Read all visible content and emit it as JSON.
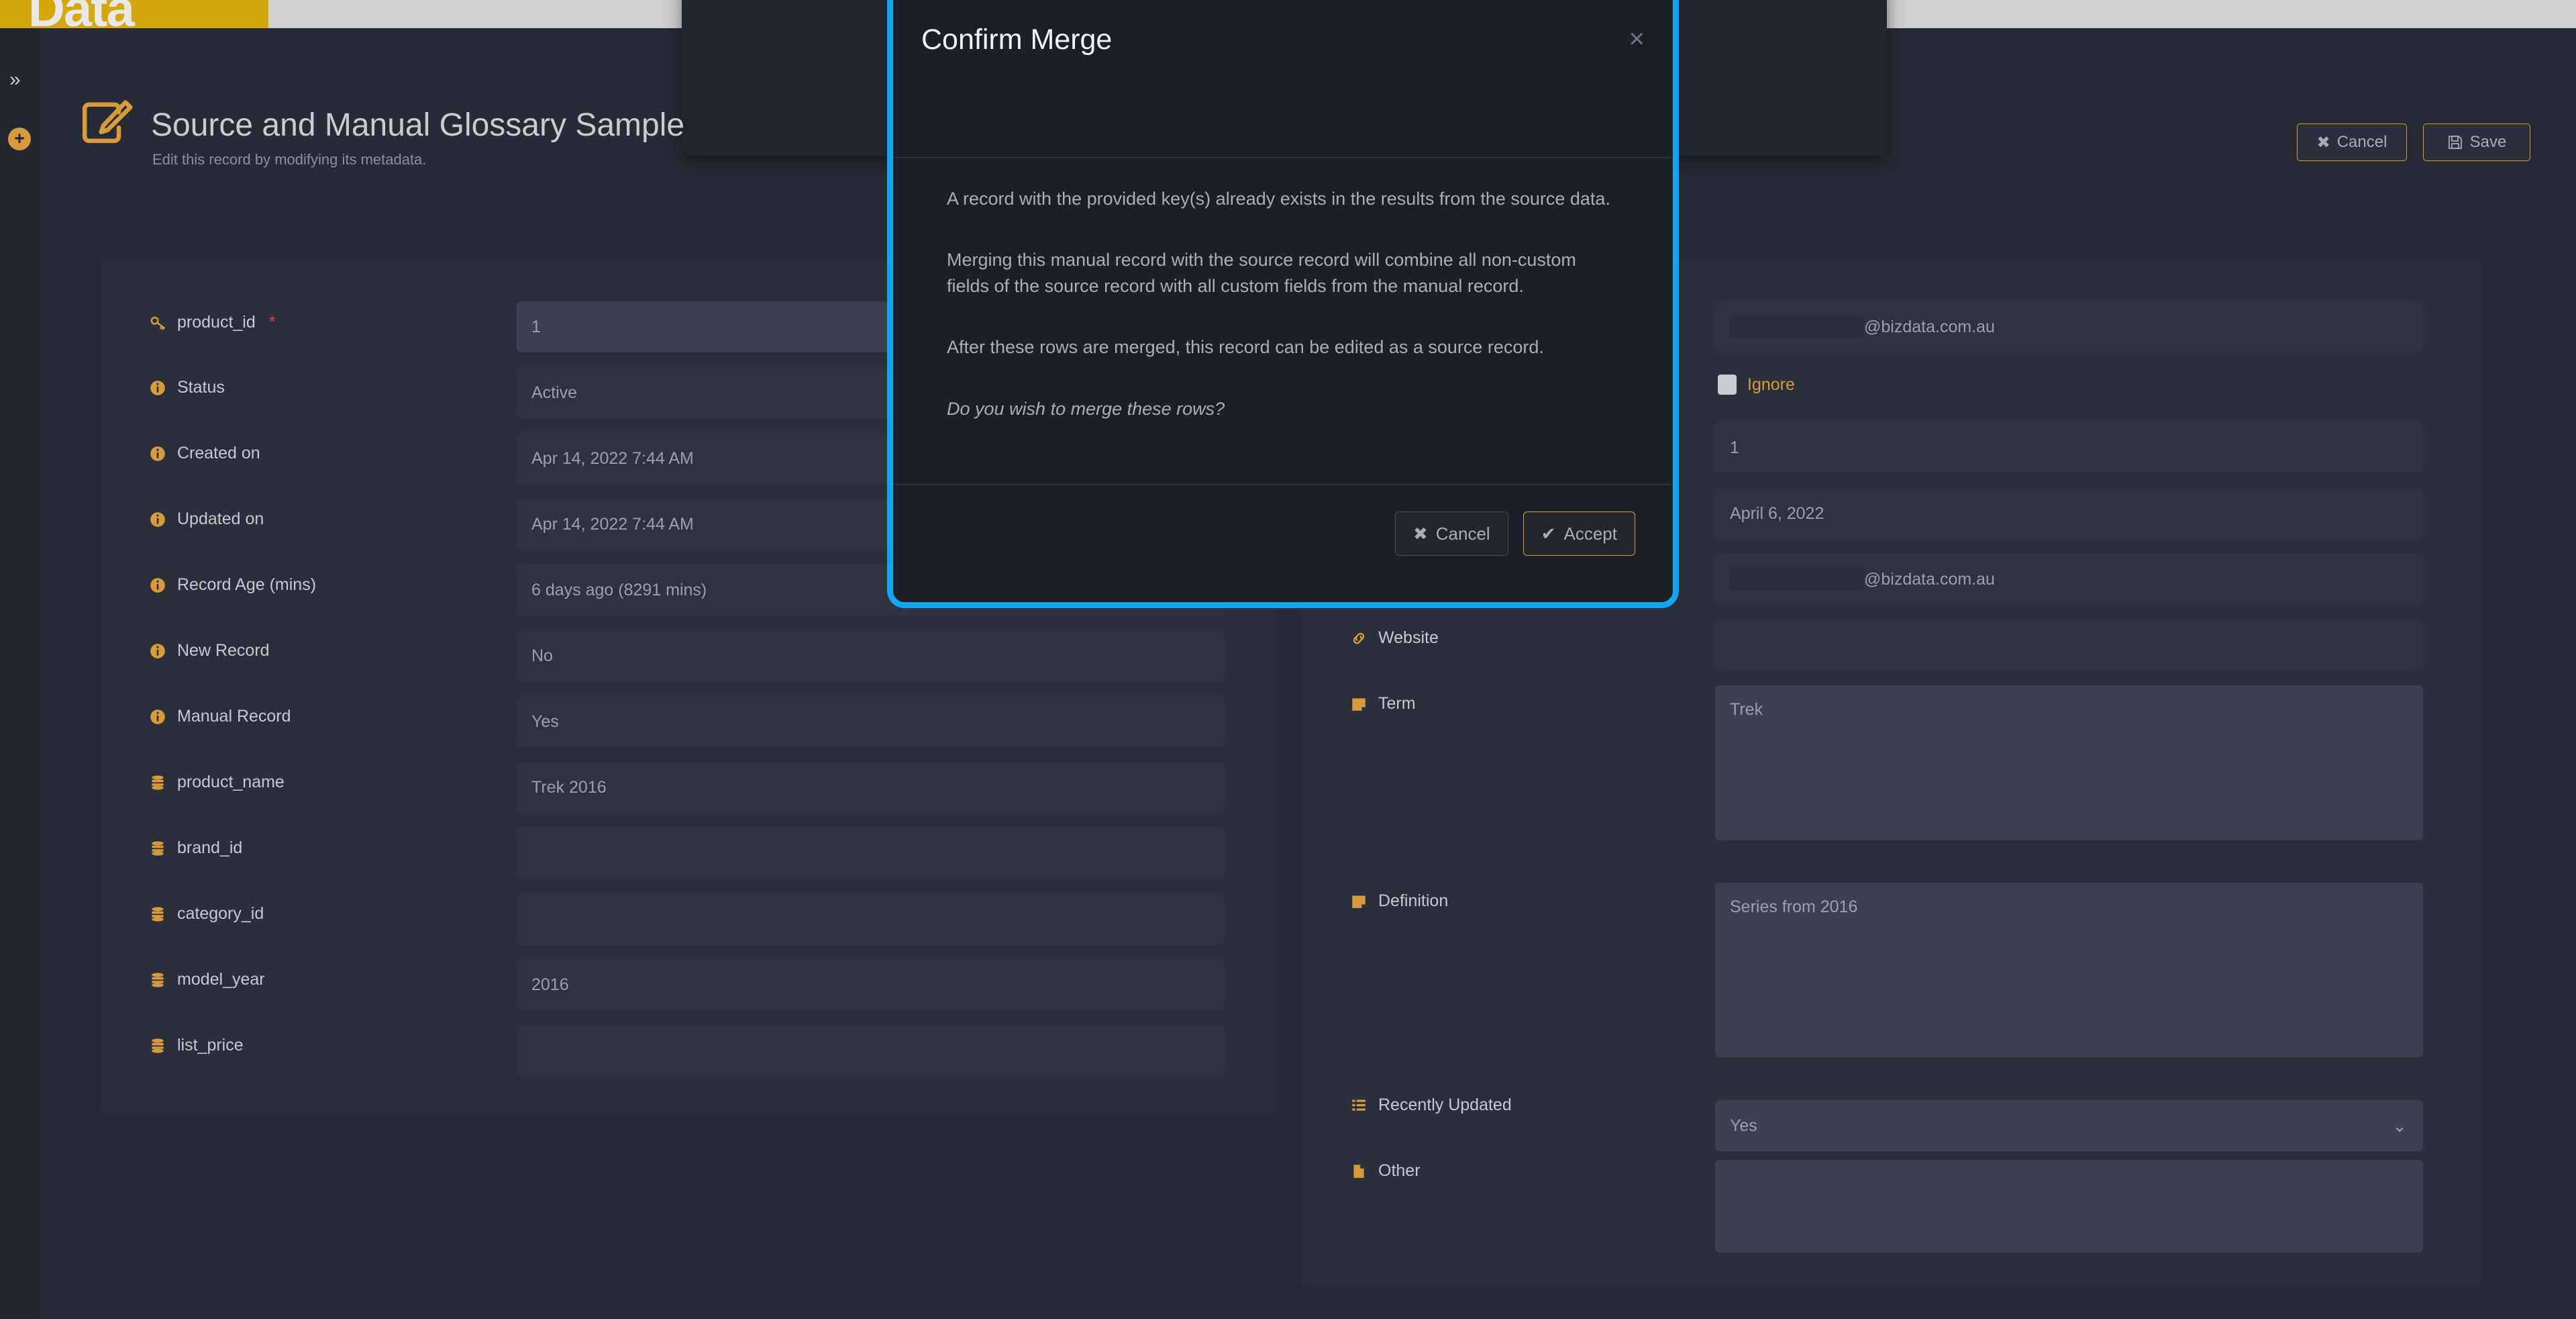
{
  "topbar": {
    "logo_text": "Data"
  },
  "rail": {
    "expand_icon": "double-chevron-right-icon",
    "add_icon": "plus-circle-icon"
  },
  "header": {
    "icon": "edit-record-icon",
    "title": "Source and Manual Glossary Sample",
    "subtitle": "Edit this record by modifying its metadata.",
    "cancel_label": "Cancel",
    "save_label": "Save",
    "cancel_icon": "close-x-icon",
    "save_icon": "floppy-disk-icon"
  },
  "left_form": {
    "fields": [
      {
        "label": "product_id",
        "icon": "key-icon",
        "required": true,
        "value": "1",
        "editable": true
      },
      {
        "label": "Status",
        "icon": "info-icon",
        "required": false,
        "value": "Active",
        "editable": false
      },
      {
        "label": "Created on",
        "icon": "info-icon",
        "required": false,
        "value": "Apr 14, 2022 7:44 AM",
        "editable": false
      },
      {
        "label": "Updated on",
        "icon": "info-icon",
        "required": false,
        "value": "Apr 14, 2022 7:44 AM",
        "editable": false
      },
      {
        "label": "Record Age (mins)",
        "icon": "info-icon",
        "required": false,
        "value": "6 days ago (8291 mins)",
        "editable": false
      },
      {
        "label": "New Record",
        "icon": "info-icon",
        "required": false,
        "value": "No",
        "editable": false
      },
      {
        "label": "Manual Record",
        "icon": "info-icon",
        "required": false,
        "value": "Yes",
        "editable": false
      },
      {
        "label": "product_name",
        "icon": "database-icon",
        "required": false,
        "value": "Trek 2016",
        "editable": false
      },
      {
        "label": "brand_id",
        "icon": "database-icon",
        "required": false,
        "value": "",
        "editable": false
      },
      {
        "label": "category_id",
        "icon": "database-icon",
        "required": false,
        "value": "",
        "editable": false
      },
      {
        "label": "model_year",
        "icon": "database-icon",
        "required": false,
        "value": "2016",
        "editable": false
      },
      {
        "label": "list_price",
        "icon": "database-icon",
        "required": false,
        "value": "",
        "editable": false
      }
    ]
  },
  "right_form": {
    "email_domain_1": "@bizdata.com.au",
    "email_domain_2": "@bizdata.com.au",
    "ignore_label": "Ignore",
    "value_number": "1",
    "value_date": "April 6, 2022",
    "fields": [
      {
        "label": "Website",
        "icon": "link-icon",
        "value": ""
      },
      {
        "label": "Term",
        "icon": "note-icon",
        "value": "Trek"
      },
      {
        "label": "Definition",
        "icon": "note-icon",
        "value": "Series from 2016"
      },
      {
        "label": "Recently Updated",
        "icon": "list-icon",
        "value": "Yes"
      },
      {
        "label": "Other",
        "icon": "file-icon",
        "value": ""
      }
    ]
  },
  "modal": {
    "title": "Confirm Merge",
    "close_icon": "close-x-icon",
    "paragraph_1": "A record with the provided key(s) already exists in the results from the source data.",
    "paragraph_2": "Merging this manual record with the source record will combine all non-custom fields of the source record with all custom fields from the manual record.",
    "paragraph_3": "After these rows are merged, this record can be edited as a source record.",
    "question": "Do you wish to merge these rows?",
    "cancel_label": "Cancel",
    "accept_label": "Accept",
    "cancel_icon": "close-x-icon",
    "accept_icon": "check-icon",
    "highlight_color": "#13a4f2"
  },
  "colors": {
    "accent": "#d99a3c",
    "logo_bar": "#d4a80c",
    "required": "#e13c3c"
  }
}
